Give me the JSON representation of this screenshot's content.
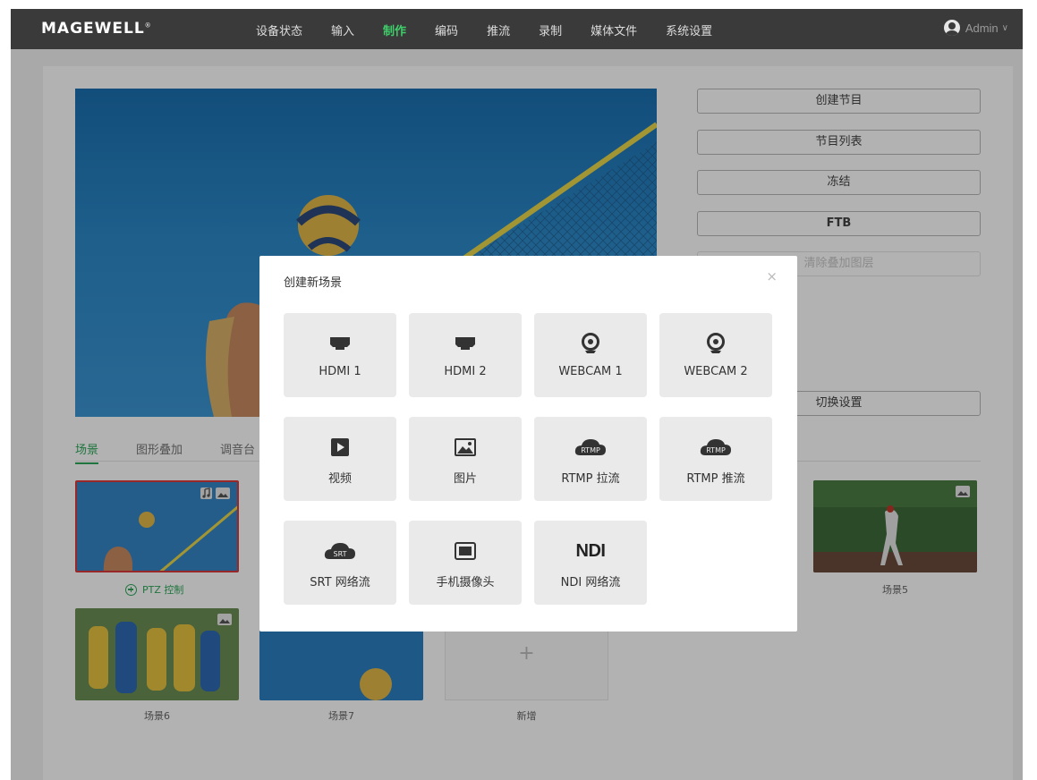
{
  "header": {
    "logo": "MAGEWELL",
    "nav": [
      "设备状态",
      "输入",
      "制作",
      "编码",
      "推流",
      "录制",
      "媒体文件",
      "系统设置"
    ],
    "active_nav": "制作",
    "user": "Admin"
  },
  "controls": {
    "create_program": "创建节目",
    "program_list": "节目列表",
    "freeze": "冻结",
    "ftb": "FTB",
    "clear_overlay": "清除叠加图层",
    "switch_settings": "切换设置"
  },
  "tabs": [
    "场景",
    "图形叠加",
    "调音台"
  ],
  "scenes": {
    "ptz_label": "PTZ 控制",
    "scene5": "场景5",
    "scene6": "场景6",
    "scene7": "场景7",
    "add_new": "新增"
  },
  "modal": {
    "title": "创建新场景",
    "close": "×",
    "sources": [
      {
        "label": "HDMI 1",
        "icon": "hdmi-icon"
      },
      {
        "label": "HDMI 2",
        "icon": "hdmi-icon"
      },
      {
        "label": "WEBCAM 1",
        "icon": "webcam-icon"
      },
      {
        "label": "WEBCAM 2",
        "icon": "webcam-icon"
      },
      {
        "label": "视频",
        "icon": "video-play-icon"
      },
      {
        "label": "图片",
        "icon": "image-icon"
      },
      {
        "label": "RTMP 拉流",
        "icon": "rtmp-cloud-icon"
      },
      {
        "label": "RTMP 推流",
        "icon": "rtmp-cloud-icon"
      },
      {
        "label": "SRT 网络流",
        "icon": "srt-cloud-icon"
      },
      {
        "label": "手机摄像头",
        "icon": "phone-camera-icon"
      },
      {
        "label": "NDI 网络流",
        "icon": "ndi-icon"
      }
    ],
    "icon_text": {
      "rtmp": "RTMP",
      "srt": "SRT",
      "ndi": "NDI"
    }
  },
  "colors": {
    "accent": "#2fa85a",
    "nav_active": "#3ecf6a",
    "selected_border": "#d9383a",
    "topbar": "#3a3a3a"
  }
}
